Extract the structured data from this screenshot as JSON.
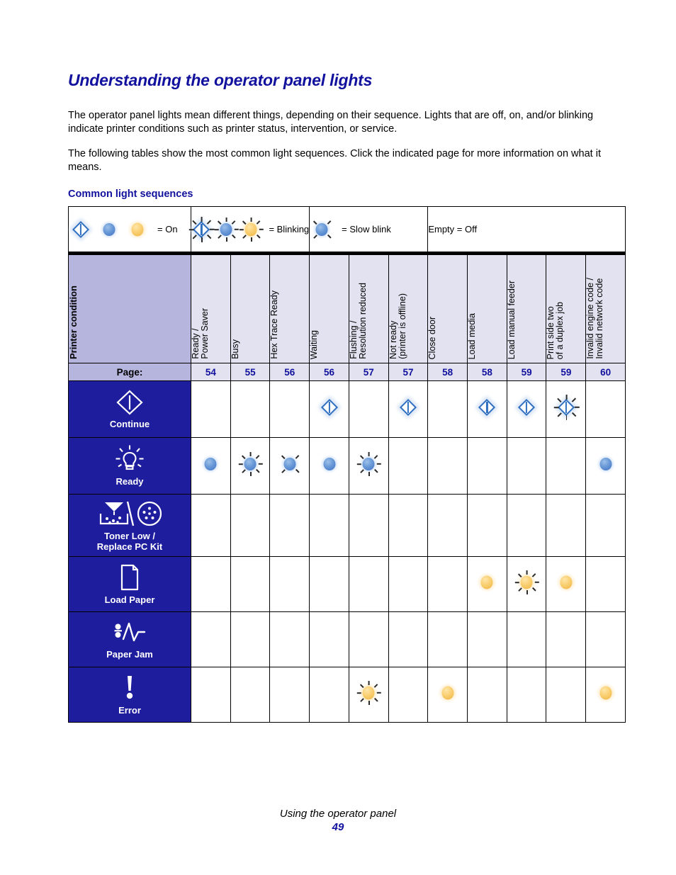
{
  "document": {
    "title": "Understanding the operator panel lights",
    "paragraphs": [
      "The operator panel lights mean different things, depending on their sequence. Lights that are off, on, and/or blinking indicate printer conditions such as printer status, intervention, or service.",
      "The following tables show the most common light sequences. Click the indicated page for more information on what it means."
    ],
    "subheading": "Common light sequences",
    "footer": {
      "chapter": "Using the operator panel",
      "page_number": "49"
    }
  },
  "colors": {
    "heading_blue": "#11119e",
    "row_label_blue": "#1d1d9e",
    "header_lavender": "#b5b5de",
    "header_light": "#e2e2f0",
    "light_blue": "#5a8fd2",
    "light_amber": "#f5c563",
    "diamond_blue": "#2f6fc0"
  },
  "legend": [
    {
      "id": "on",
      "icons": [
        "diamond-on",
        "blue-on",
        "amber-on"
      ],
      "label": "= On"
    },
    {
      "id": "blinking",
      "icons": [
        "diamond-blink",
        "blue-blink",
        "amber-blink"
      ],
      "label": "= Blinking"
    },
    {
      "id": "slow-blink",
      "icons": [
        "blue-slow"
      ],
      "label": "= Slow blink"
    },
    {
      "id": "off",
      "icons": [],
      "label": "Empty = Off"
    }
  ],
  "table": {
    "condition_header": "Printer condition",
    "page_label": "Page:",
    "columns": [
      {
        "header": "Ready /\nPower Saver",
        "page": "54"
      },
      {
        "header": "Busy",
        "page": "55"
      },
      {
        "header": "Hex Trace Ready",
        "page": "56"
      },
      {
        "header": "Waiting",
        "page": "56"
      },
      {
        "header": "Flushing /\nResolution reduced",
        "page": "57"
      },
      {
        "header": "Not ready\n(printer is offline)",
        "page": "57"
      },
      {
        "header": "Close door",
        "page": "58"
      },
      {
        "header": "Load media",
        "page": "58"
      },
      {
        "header": "Load manual feeder",
        "page": "59"
      },
      {
        "header": "Print side two\nof a duplex job",
        "page": "59"
      },
      {
        "header": "Invalid engine code /\nInvalid network code",
        "page": "60"
      }
    ],
    "rows": [
      {
        "id": "continue",
        "label": "Continue",
        "icon": "continue-diamond-icon",
        "cells": [
          "",
          "",
          "",
          "diamond-on",
          "",
          "diamond-on",
          "",
          "diamond-on",
          "diamond-on",
          "diamond-blink",
          ""
        ]
      },
      {
        "id": "ready",
        "label": "Ready",
        "icon": "ready-lightbulb-icon",
        "cells": [
          "blue-on",
          "blue-blink",
          "blue-slow",
          "blue-on",
          "blue-blink",
          "",
          "",
          "",
          "",
          "",
          "blue-on"
        ]
      },
      {
        "id": "toner-low",
        "label": "Toner Low /\nReplace PC Kit",
        "icon": "toner-low-icon",
        "cells": [
          "",
          "",
          "",
          "",
          "",
          "",
          "",
          "",
          "",
          "",
          ""
        ]
      },
      {
        "id": "load-paper",
        "label": "Load Paper",
        "icon": "load-paper-icon",
        "cells": [
          "",
          "",
          "",
          "",
          "",
          "",
          "",
          "amber-on",
          "amber-blink",
          "amber-on",
          ""
        ]
      },
      {
        "id": "paper-jam",
        "label": "Paper Jam",
        "icon": "paper-jam-icon",
        "cells": [
          "",
          "",
          "",
          "",
          "",
          "",
          "",
          "",
          "",
          "",
          ""
        ]
      },
      {
        "id": "error",
        "label": "Error",
        "icon": "error-exclamation-icon",
        "cells": [
          "",
          "",
          "",
          "",
          "amber-blink",
          "",
          "amber-on",
          "",
          "",
          "",
          "amber-on"
        ]
      }
    ]
  }
}
